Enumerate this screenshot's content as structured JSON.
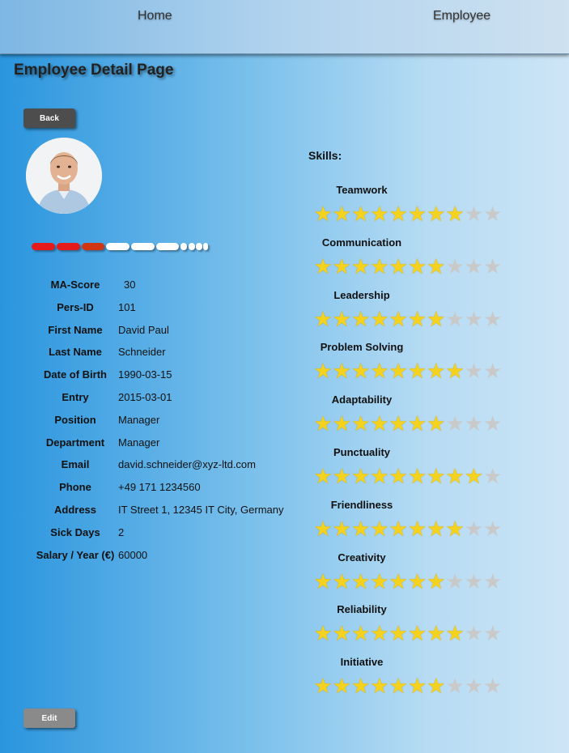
{
  "nav": {
    "home": "Home",
    "employee": "Employee"
  },
  "page_title": "Employee Detail Page",
  "buttons": {
    "back": "Back",
    "edit": "Edit"
  },
  "ma_score_bar": {
    "filled_segments": 3,
    "total_segments": 10,
    "colors": {
      "red": "#e51b1b",
      "orange_red": "#d03612",
      "empty": "#ffffff"
    }
  },
  "details": [
    {
      "label": "MA-Score",
      "value": "30"
    },
    {
      "label": "Pers-ID",
      "value": "101"
    },
    {
      "label": "First Name",
      "value": "David Paul"
    },
    {
      "label": "Last Name",
      "value": "Schneider"
    },
    {
      "label": "Date of Birth",
      "value": "1990-03-15"
    },
    {
      "label": "Entry",
      "value": "2015-03-01"
    },
    {
      "label": "Position",
      "value": "Manager"
    },
    {
      "label": "Department",
      "value": "Manager"
    },
    {
      "label": "Email",
      "value": "david.schneider@xyz-ltd.com"
    },
    {
      "label": "Phone",
      "value": "+49 171 1234560"
    },
    {
      "label": "Address",
      "value": "IT Street 1, 12345 IT City, Germany"
    },
    {
      "label": "Sick Days",
      "value": "2"
    },
    {
      "label": "Salary / Year (€)",
      "value": "60000"
    }
  ],
  "skills_title": "Skills:",
  "skills_max": 10,
  "skills": [
    {
      "name": "Teamwork",
      "rating": 8
    },
    {
      "name": "Communication",
      "rating": 7
    },
    {
      "name": "Leadership",
      "rating": 7
    },
    {
      "name": "Problem Solving",
      "rating": 8
    },
    {
      "name": "Adaptability",
      "rating": 7
    },
    {
      "name": "Punctuality",
      "rating": 9
    },
    {
      "name": "Friendliness",
      "rating": 8
    },
    {
      "name": "Creativity",
      "rating": 7
    },
    {
      "name": "Reliability",
      "rating": 8
    },
    {
      "name": "Initiative",
      "rating": 7
    }
  ]
}
